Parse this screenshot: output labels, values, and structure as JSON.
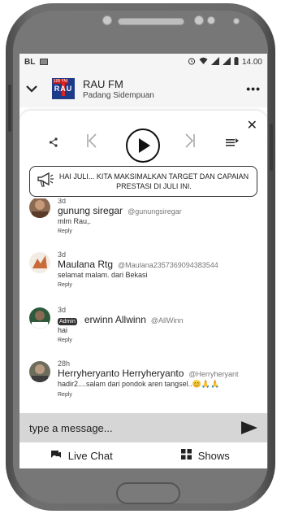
{
  "status_bar": {
    "carrier": "BL",
    "time": "14.00",
    "icons": [
      "image-icon",
      "alarm-icon",
      "wifi-icon",
      "signal-icon",
      "signal-icon",
      "battery-icon"
    ]
  },
  "player": {
    "collapse_icon": "chevron-down-icon",
    "logo_top_text": "105 FM",
    "logo_text": "RAU",
    "station_name": "RAU FM",
    "station_city": "Padang Sidempuan",
    "more_label": "•••"
  },
  "controls": {
    "close_label": "✕",
    "icons": [
      "share-icon",
      "previous-icon",
      "play-icon",
      "next-icon",
      "playlist-icon"
    ]
  },
  "announcement": {
    "icon": "megaphone-icon",
    "text": "HAI JULI... KITA MAKSIMALKAN TARGET DAN CAPAIAN PRESTASI DI JULI INI."
  },
  "messages": [
    {
      "time": "3d",
      "name": "gunung siregar",
      "handle": "@gunungsiregar",
      "text": "mlm Rau,.",
      "reply": "Reply",
      "admin": false
    },
    {
      "time": "3d",
      "name": "Maulana Rtg",
      "handle": "@Maulana2357369094383544",
      "text": "selamat malam. dari Bekasi",
      "reply": "Reply",
      "admin": false
    },
    {
      "time": "3d",
      "name": "erwinn Allwinn",
      "handle": "@AllWinn",
      "text": "hai",
      "reply": "Reply",
      "admin": true,
      "badge": "Admin"
    },
    {
      "time": "28h",
      "name": "Herryheryanto Herryheryanto",
      "handle": "@Herryheryant",
      "text": "hadir2....salam dari pondok aren tangsel..😊🙏🙏",
      "reply": "Reply",
      "admin": false
    }
  ],
  "composer": {
    "placeholder": "type a message...",
    "send_icon": "send-icon"
  },
  "tabs": [
    {
      "label": "Live Chat",
      "icon": "chat-icon"
    },
    {
      "label": "Shows",
      "icon": "grid-icon"
    }
  ]
}
